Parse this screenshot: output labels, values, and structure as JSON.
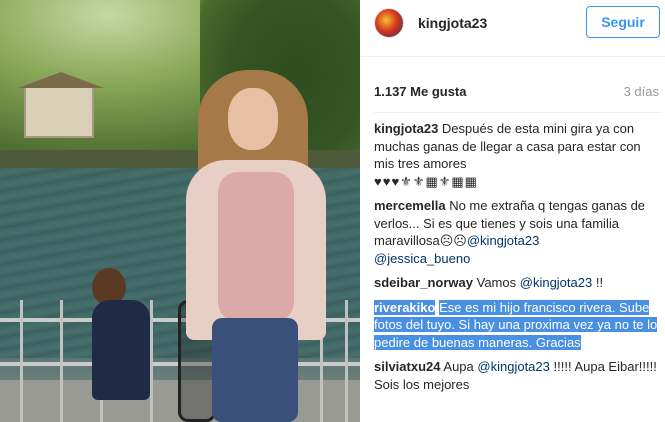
{
  "header": {
    "username": "kingjota23",
    "follow_label": "Seguir"
  },
  "stats": {
    "likes": "1.137 Me gusta",
    "time": "3 días"
  },
  "comments": [
    {
      "user": "kingjota23",
      "text": "Después de esta mini gira ya con muchas ganas de llegar a casa para estar con mis tres amores",
      "emoji_line": "♥♥♥⚜⚜▦⚜▦▦"
    },
    {
      "user": "mercemella",
      "text": "No me extraña q tengas ganas de verlos... Si es que tienes y sois una familia maravillosa☹☹",
      "mention1": "@kingjota23",
      "mention2": "@jessica_bueno"
    },
    {
      "user": "sdeibar_norway",
      "text": "Vamos",
      "mention": "@kingjota23",
      "text_after": "!!"
    },
    {
      "user": "riverakiko",
      "text": "Ese es mi hijo francisco rivera. Sube fotos del tuyo. Si hay una proxima vez ya no te lo pedire de buenas maneras. Gracias"
    },
    {
      "user": "silviatxu24",
      "text": "Aupa",
      "mention": "@kingjota23",
      "text_after": "!!!!! Aupa Eibar!!!!! Sois los mejores"
    }
  ],
  "colors": {
    "follow_blue": "#3897f0",
    "mention_blue": "#003569",
    "highlight": "#4a90e2"
  }
}
